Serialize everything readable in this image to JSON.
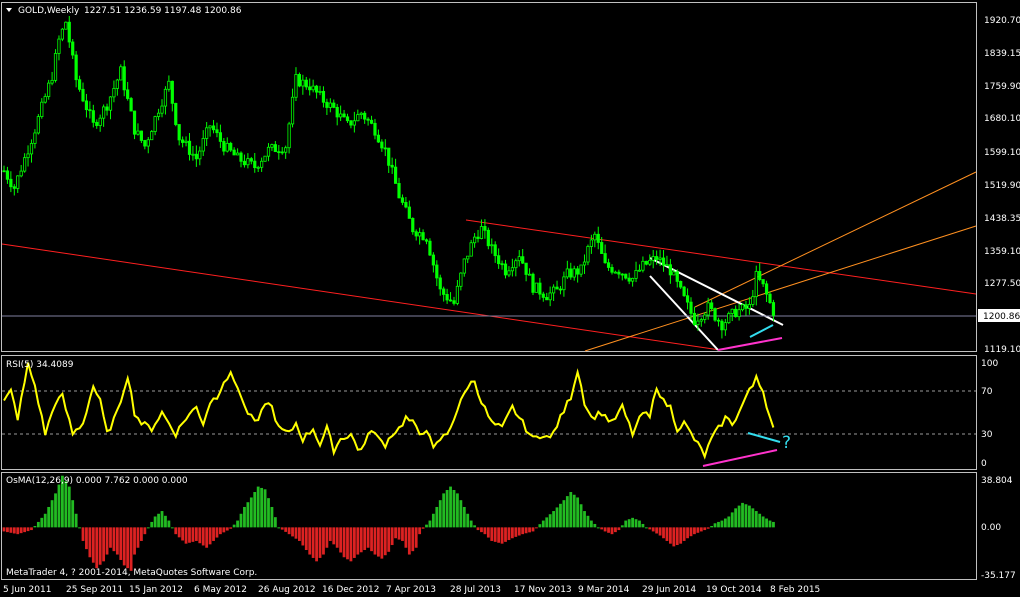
{
  "header": {
    "symbol": "GOLD,Weekly",
    "ohlc": "1227.51 1236.59 1197.48 1200.86"
  },
  "colors": {
    "background": "#000000",
    "frame": "#c0c0c0",
    "bull_candle": "#00ff00",
    "price_line": "#8080a0",
    "channel_red": "#ff2020",
    "channel_orange": "#ff9020",
    "wedge_white": "#ffffff",
    "divergence_magenta": "#ff33cc",
    "divergence_cyan": "#33ddee",
    "rsi_line": "#ffff00",
    "osma_up": "#22bb22",
    "osma_down": "#dd2222"
  },
  "price_axis": {
    "labels": [
      "1920.70",
      "1839.15",
      "1759.90",
      "1680.10",
      "1599.10",
      "1519.90",
      "1438.35",
      "1359.10",
      "1277.50",
      "1119.10"
    ],
    "current_label": "1200.86",
    "ylim": [
      1105,
      1945
    ]
  },
  "rsi_panel": {
    "title": "RSI(5) 34.4089",
    "labels": [
      "100",
      "70",
      "30",
      "0"
    ],
    "levels": [
      70,
      30
    ],
    "ylim": [
      -3,
      103
    ],
    "annotation": "?"
  },
  "osma_panel": {
    "title": "OsMA(12,26,9) 0.000 7.762 0.000 0.000",
    "labels": [
      "38.804",
      "0.00",
      "-35.177"
    ],
    "ylim": [
      -38,
      40
    ]
  },
  "time_axis": {
    "labels": [
      "5 Jun 2011",
      "25 Sep 2011",
      "15 Jan 2012",
      "6 May 2012",
      "26 Aug 2012",
      "16 Dec 2012",
      "7 Apr 2013",
      "28 Jul 2013",
      "17 Nov 2013",
      "9 Mar 2014",
      "29 Jun 2014",
      "19 Oct 2014",
      "8 Feb 2015"
    ]
  },
  "copyright": "MetaTrader 4, ? 2001-2014, MetaQuotes Software Corp.",
  "chart_data": {
    "type": "line",
    "title": "GOLD,Weekly",
    "note": "candlestick price panel with RSI(5) and OsMA(12,26,9) sub-panels; values approximate, one per weekly bar",
    "x": [
      "5 Jun 2011",
      "25 Sep 2011",
      "15 Jan 2012",
      "6 May 2012",
      "26 Aug 2012",
      "16 Dec 2012",
      "7 Apr 2013",
      "28 Jul 2013",
      "17 Nov 2013",
      "9 Mar 2014",
      "29 Jun 2014",
      "19 Oct 2014",
      "8 Feb 2015"
    ],
    "price_anchors": [
      [
        0,
        1540
      ],
      [
        3,
        1500
      ],
      [
        9,
        1640
      ],
      [
        14,
        1770
      ],
      [
        16,
        1855
      ],
      [
        18,
        1900
      ],
      [
        21,
        1760
      ],
      [
        26,
        1650
      ],
      [
        30,
        1700
      ],
      [
        34,
        1780
      ],
      [
        38,
        1640
      ],
      [
        41,
        1600
      ],
      [
        45,
        1690
      ],
      [
        48,
        1750
      ],
      [
        51,
        1620
      ],
      [
        56,
        1570
      ],
      [
        60,
        1650
      ],
      [
        64,
        1600
      ],
      [
        68,
        1570
      ],
      [
        73,
        1550
      ],
      [
        77,
        1590
      ],
      [
        82,
        1600
      ],
      [
        85,
        1760
      ],
      [
        89,
        1745
      ],
      [
        93,
        1710
      ],
      [
        96,
        1690
      ],
      [
        100,
        1650
      ],
      [
        104,
        1680
      ],
      [
        108,
        1640
      ],
      [
        111,
        1590
      ],
      [
        115,
        1480
      ],
      [
        119,
        1400
      ],
      [
        123,
        1380
      ],
      [
        127,
        1250
      ],
      [
        131,
        1220
      ],
      [
        134,
        1320
      ],
      [
        137,
        1380
      ],
      [
        139,
        1400
      ],
      [
        142,
        1350
      ],
      [
        146,
        1300
      ],
      [
        150,
        1340
      ],
      [
        154,
        1260
      ],
      [
        158,
        1240
      ],
      [
        161,
        1250
      ],
      [
        164,
        1290
      ],
      [
        168,
        1300
      ],
      [
        170,
        1350
      ],
      [
        172,
        1385
      ],
      [
        175,
        1310
      ],
      [
        179,
        1300
      ],
      [
        183,
        1280
      ],
      [
        186,
        1310
      ],
      [
        190,
        1330
      ],
      [
        194,
        1300
      ],
      [
        198,
        1230
      ],
      [
        201,
        1180
      ],
      [
        205,
        1210
      ],
      [
        209,
        1170
      ],
      [
        213,
        1200
      ],
      [
        217,
        1210
      ],
      [
        219,
        1285
      ],
      [
        221,
        1260
      ],
      [
        223,
        1220
      ],
      [
        224,
        1201
      ]
    ],
    "rsi_anchors": [
      [
        0,
        60
      ],
      [
        2,
        70
      ],
      [
        4,
        45
      ],
      [
        7,
        95
      ],
      [
        9,
        75
      ],
      [
        12,
        30
      ],
      [
        15,
        60
      ],
      [
        17,
        65
      ],
      [
        20,
        30
      ],
      [
        23,
        40
      ],
      [
        26,
        75
      ],
      [
        28,
        60
      ],
      [
        30,
        30
      ],
      [
        33,
        50
      ],
      [
        36,
        85
      ],
      [
        38,
        50
      ],
      [
        40,
        40
      ],
      [
        43,
        35
      ],
      [
        46,
        50
      ],
      [
        48,
        40
      ],
      [
        50,
        30
      ],
      [
        53,
        45
      ],
      [
        56,
        55
      ],
      [
        58,
        40
      ],
      [
        60,
        60
      ],
      [
        62,
        65
      ],
      [
        64,
        80
      ],
      [
        66,
        85
      ],
      [
        68,
        75
      ],
      [
        70,
        55
      ],
      [
        72,
        45
      ],
      [
        74,
        40
      ],
      [
        76,
        60
      ],
      [
        78,
        55
      ],
      [
        80,
        35
      ],
      [
        83,
        30
      ],
      [
        85,
        40
      ],
      [
        87,
        25
      ],
      [
        90,
        35
      ],
      [
        92,
        20
      ],
      [
        94,
        35
      ],
      [
        96,
        15
      ],
      [
        98,
        25
      ],
      [
        101,
        30
      ],
      [
        103,
        15
      ],
      [
        105,
        20
      ],
      [
        107,
        35
      ],
      [
        109,
        25
      ],
      [
        111,
        20
      ],
      [
        113,
        30
      ],
      [
        115,
        35
      ],
      [
        117,
        45
      ],
      [
        119,
        40
      ],
      [
        121,
        30
      ],
      [
        123,
        35
      ],
      [
        125,
        15
      ],
      [
        127,
        25
      ],
      [
        129,
        30
      ],
      [
        131,
        45
      ],
      [
        133,
        60
      ],
      [
        135,
        75
      ],
      [
        137,
        80
      ],
      [
        139,
        60
      ],
      [
        142,
        40
      ],
      [
        145,
        35
      ],
      [
        148,
        55
      ],
      [
        151,
        40
      ],
      [
        154,
        25
      ],
      [
        157,
        30
      ],
      [
        159,
        25
      ],
      [
        162,
        45
      ],
      [
        165,
        65
      ],
      [
        167,
        90
      ],
      [
        169,
        60
      ],
      [
        171,
        45
      ],
      [
        174,
        50
      ],
      [
        177,
        40
      ],
      [
        180,
        55
      ],
      [
        183,
        30
      ],
      [
        186,
        50
      ],
      [
        188,
        45
      ],
      [
        190,
        75
      ],
      [
        192,
        60
      ],
      [
        194,
        55
      ],
      [
        196,
        35
      ],
      [
        198,
        40
      ],
      [
        200,
        30
      ],
      [
        202,
        20
      ],
      [
        204,
        10
      ],
      [
        206,
        25
      ],
      [
        208,
        35
      ],
      [
        210,
        45
      ],
      [
        212,
        40
      ],
      [
        214,
        50
      ],
      [
        216,
        65
      ],
      [
        218,
        75
      ],
      [
        219,
        85
      ],
      [
        221,
        70
      ],
      [
        223,
        45
      ],
      [
        224,
        34
      ]
    ],
    "osma_anchors": [
      [
        0,
        -3
      ],
      [
        4,
        -5
      ],
      [
        8,
        -2
      ],
      [
        12,
        10
      ],
      [
        15,
        25
      ],
      [
        17,
        38
      ],
      [
        19,
        30
      ],
      [
        21,
        10
      ],
      [
        23,
        -10
      ],
      [
        25,
        -22
      ],
      [
        27,
        -30
      ],
      [
        29,
        -25
      ],
      [
        31,
        -15
      ],
      [
        33,
        -20
      ],
      [
        35,
        -28
      ],
      [
        37,
        -32
      ],
      [
        38,
        -20
      ],
      [
        40,
        -10
      ],
      [
        42,
        0
      ],
      [
        44,
        8
      ],
      [
        46,
        12
      ],
      [
        48,
        5
      ],
      [
        50,
        -5
      ],
      [
        53,
        -12
      ],
      [
        56,
        -10
      ],
      [
        59,
        -15
      ],
      [
        61,
        -10
      ],
      [
        63,
        -5
      ],
      [
        66,
        -1
      ],
      [
        68,
        5
      ],
      [
        70,
        15
      ],
      [
        72,
        22
      ],
      [
        74,
        30
      ],
      [
        76,
        28
      ],
      [
        78,
        15
      ],
      [
        80,
        0
      ],
      [
        83,
        -5
      ],
      [
        86,
        -10
      ],
      [
        89,
        -20
      ],
      [
        91,
        -25
      ],
      [
        93,
        -20
      ],
      [
        95,
        -10
      ],
      [
        97,
        -15
      ],
      [
        99,
        -22
      ],
      [
        101,
        -25
      ],
      [
        103,
        -20
      ],
      [
        106,
        -15
      ],
      [
        108,
        -20
      ],
      [
        110,
        -23
      ],
      [
        112,
        -18
      ],
      [
        114,
        -8
      ],
      [
        116,
        -10
      ],
      [
        118,
        -20
      ],
      [
        120,
        -15
      ],
      [
        121,
        -5
      ],
      [
        122,
        -1
      ],
      [
        124,
        5
      ],
      [
        126,
        15
      ],
      [
        128,
        25
      ],
      [
        130,
        30
      ],
      [
        132,
        25
      ],
      [
        134,
        15
      ],
      [
        136,
        5
      ],
      [
        138,
        -2
      ],
      [
        140,
        -5
      ],
      [
        142,
        -10
      ],
      [
        145,
        -12
      ],
      [
        148,
        -8
      ],
      [
        151,
        -5
      ],
      [
        154,
        -3
      ],
      [
        157,
        5
      ],
      [
        160,
        12
      ],
      [
        163,
        20
      ],
      [
        165,
        26
      ],
      [
        167,
        22
      ],
      [
        169,
        12
      ],
      [
        171,
        5
      ],
      [
        173,
        0
      ],
      [
        175,
        -3
      ],
      [
        177,
        -5
      ],
      [
        179,
        -2
      ],
      [
        181,
        5
      ],
      [
        183,
        7
      ],
      [
        185,
        5
      ],
      [
        187,
        0
      ],
      [
        189,
        -3
      ],
      [
        191,
        -6
      ],
      [
        193,
        -10
      ],
      [
        195,
        -14
      ],
      [
        197,
        -12
      ],
      [
        199,
        -8
      ],
      [
        201,
        -5
      ],
      [
        203,
        -3
      ],
      [
        205,
        -1
      ],
      [
        207,
        3
      ],
      [
        209,
        5
      ],
      [
        211,
        8
      ],
      [
        213,
        14
      ],
      [
        215,
        18
      ],
      [
        217,
        16
      ],
      [
        219,
        12
      ],
      [
        221,
        8
      ],
      [
        223,
        5
      ],
      [
        224,
        4
      ]
    ]
  }
}
